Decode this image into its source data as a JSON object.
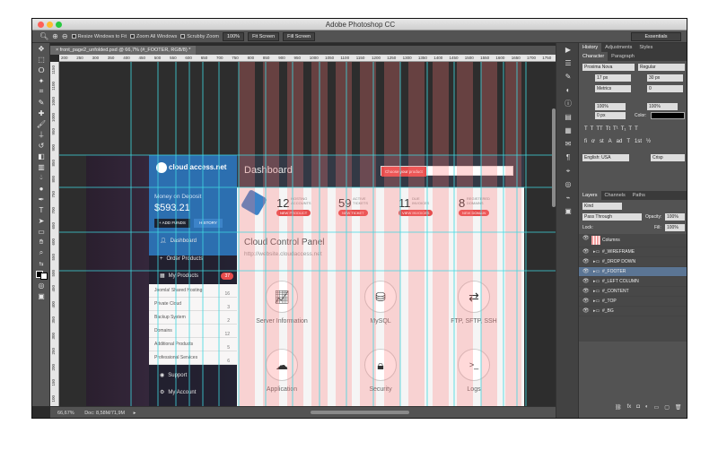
{
  "window": {
    "title": "Adobe Photoshop CC"
  },
  "options": {
    "resize": "Resize Windows to Fit",
    "zoom_all": "Zoom All Windows",
    "scrubby": "Scrubby Zoom",
    "btn_100": "100%",
    "fit": "Fit Screen",
    "fill": "Fill Screen",
    "workspace": "Essentials"
  },
  "document": {
    "tab": "front_page2_unfolded.psd @ 66,7% (#_FOOTER, RGB/8) *",
    "zoom": "66,67%",
    "doc": "Doc: 8,58M/71,9M"
  },
  "ruler_h": [
    "200",
    "250",
    "300",
    "350",
    "400",
    "450",
    "500",
    "550",
    "600",
    "650",
    "700",
    "750",
    "800",
    "850",
    "900",
    "950",
    "1000",
    "1050",
    "1100",
    "1150",
    "1200",
    "1250",
    "1300",
    "1350",
    "1400",
    "1450",
    "1500",
    "1550",
    "1600",
    "1650",
    "1700",
    "1750"
  ],
  "ruler_v": [
    "1150",
    "1100",
    "1050",
    "1000",
    "950",
    "900",
    "850",
    "800",
    "750",
    "700",
    "650",
    "600",
    "550",
    "500",
    "450",
    "400",
    "350",
    "300",
    "250",
    "200",
    "150",
    "100"
  ],
  "site": {
    "logo": "cloud access.net",
    "money_label": "Money on Deposit",
    "money_value": "$593.21",
    "add_funds": "+ ADD FUNDS",
    "history": "HISTORY",
    "nav": [
      {
        "label": "Dashboard",
        "icon": "user-icon"
      },
      {
        "label": "Order Products",
        "icon": "plus-icon"
      },
      {
        "label": "My Products",
        "icon": "box-icon",
        "badge": "37"
      }
    ],
    "sub": [
      {
        "label": "Joomla! Shared Hosting",
        "count": "16"
      },
      {
        "label": "Private Cloud",
        "count": "3"
      },
      {
        "label": "Backup System",
        "count": "2"
      },
      {
        "label": "Domains",
        "count": "12"
      },
      {
        "label": "Additional Products",
        "count": "5"
      },
      {
        "label": "Professional Services",
        "count": "6"
      }
    ],
    "nav2": [
      {
        "label": "Support"
      },
      {
        "label": "My Account"
      }
    ],
    "dashboard": "Dashboard",
    "choose": "Choose your product",
    "stats": [
      {
        "num": "12",
        "label": "HOSTING ACCOUNTS",
        "btn": "NEW PRODUCT"
      },
      {
        "num": "59",
        "label": "ACTIVE TICKETS",
        "btn": "NEW TICKET"
      },
      {
        "num": "11",
        "label": "DUE INVOICES",
        "btn": "VIEW INVOICES"
      },
      {
        "num": "8",
        "label": "REGISTERED DOMAINS",
        "btn": "NEW DOMAIN"
      }
    ],
    "panel_title": "Cloud Control Panel",
    "panel_url": "http://website.cloudaccess.net",
    "tiles": [
      {
        "label": "Server Information",
        "icon": "chart-icon"
      },
      {
        "label": "MySQL",
        "icon": "database-icon"
      },
      {
        "label": "FTP, SFTP, SSH",
        "icon": "transfer-icon"
      },
      {
        "label": "Application",
        "icon": "cloud-upload-icon"
      },
      {
        "label": "Security",
        "icon": "lock-icon"
      },
      {
        "label": "Logs",
        "icon": "terminal-icon"
      }
    ]
  },
  "panels": {
    "tabs1": [
      "History",
      "Adjustments",
      "Styles"
    ],
    "tabs2": [
      "Character",
      "Paragraph"
    ],
    "font": "Proxima Nova",
    "style": "Regular",
    "size": "17 px",
    "leading": "30 px",
    "kern": "Metrics",
    "track": "0",
    "vscale": "100%",
    "hscale": "100%",
    "baseline": "0 px",
    "color_label": "Color:",
    "lang": "English: USA",
    "aa": "Crisp",
    "layer_tabs": [
      "Layers",
      "Channels",
      "Paths"
    ],
    "kind": "Kind",
    "blend": "Pass Through",
    "opacity_label": "Opacity:",
    "opacity": "100%",
    "lock_label": "Lock:",
    "fill_label": "Fill:",
    "fill": "100%",
    "layers": [
      {
        "name": "Columns",
        "thumb": true
      },
      {
        "name": "#_WIREFRAME"
      },
      {
        "name": "#_DROP DOWN"
      },
      {
        "name": "#_FOOTER",
        "selected": true
      },
      {
        "name": "#_LEFT COLUMN"
      },
      {
        "name": "#_CONTENT"
      },
      {
        "name": "#_TOP"
      },
      {
        "name": "#_BG"
      }
    ],
    "text_buttons": [
      "T",
      "T",
      "TT",
      "Tt",
      "T¹",
      "T₁",
      "T",
      "T"
    ],
    "ot_buttons": [
      "fi",
      "ơ",
      "st",
      "A",
      "ad",
      "T",
      "1st",
      "½"
    ]
  }
}
